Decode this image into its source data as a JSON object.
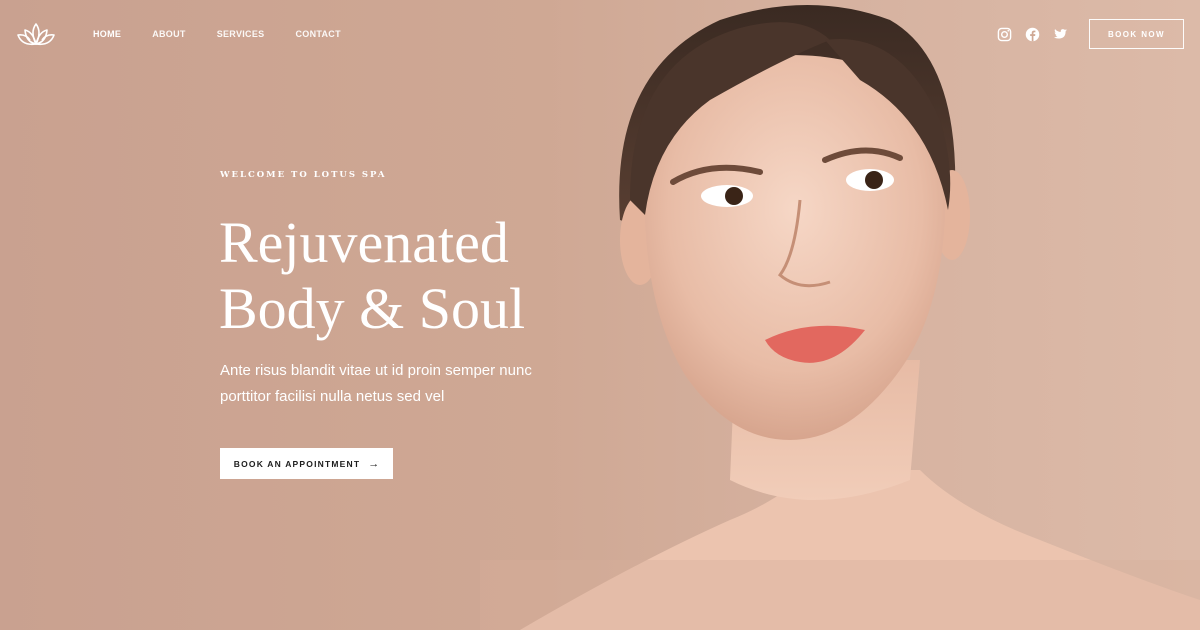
{
  "brand": {
    "logo_icon": "lotus-icon"
  },
  "nav": {
    "items": [
      {
        "label": "HOME"
      },
      {
        "label": "ABOUT"
      },
      {
        "label": "SERVICES"
      },
      {
        "label": "CONTACT"
      }
    ]
  },
  "social": [
    "instagram-icon",
    "facebook-icon",
    "twitter-icon"
  ],
  "header": {
    "book_now_label": "BOOK NOW"
  },
  "hero": {
    "eyebrow": "WELCOME TO LOTUS SPA",
    "headline_line1": "Rejuvenated",
    "headline_line2": "Body & Soul",
    "subtext_line1": "Ante risus blandit vitae ut id proin semper nunc",
    "subtext_line2": "porttitor facilisi nulla netus sed vel",
    "cta_label": "BOOK AN APPOINTMENT",
    "cta_arrow": "→"
  },
  "colors": {
    "background": "#cfa894",
    "text": "#ffffff",
    "cta_background": "#ffffff",
    "cta_text": "#1d1d1d",
    "lips": "#e2685f"
  }
}
